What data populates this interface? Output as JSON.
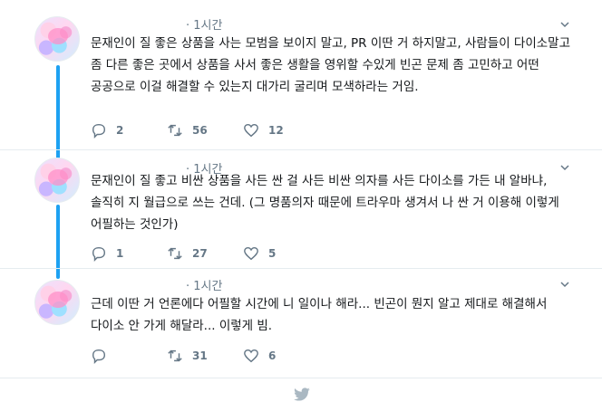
{
  "tweets": [
    {
      "time": "· 1시간",
      "text": "문재인이 질 좋은 상품을 사는 모범을 보이지 말고, PR 이딴 거 하지말고, 사람들이 다이소말고 좀 다른 좋은 곳에서 상품을 사서 좋은 생활을 영위할 수있게 빈곤 문제 좀 고민하고 어떤 공공으로 이걸 해결할 수 있는지 대가리 굴리며 모색하라는 거임.",
      "replies": "2",
      "retweets": "56",
      "likes": "12"
    },
    {
      "time": "· 1시간",
      "text": "문재인이 질 좋고 비싼 상품을 사든 싼 걸 사든 비싼 의자를 사든 다이소를 가든 내 알바냐, 솔직히 지 월급으로 쓰는 건데. (그 명품의자 때문에 트라우마 생겨서 나 싼 거 이용해 이렇게 어필하는 것인가)",
      "replies": "1",
      "retweets": "27",
      "likes": "5"
    },
    {
      "time": "· 1시간",
      "text": "근데 이딴 거 언론에다 어필할 시간에 니 일이나 해라... 빈곤이 뭔지 알고 제대로 해결해서 다이소 안 가게 해달라... 이렇게 빔.",
      "replies": "",
      "retweets": "31",
      "likes": "6"
    }
  ],
  "icons": {
    "reply": "reply-icon",
    "retweet": "retweet-icon",
    "like": "heart-icon",
    "more": "chevron-down-icon",
    "footer": "twitter-bird-icon"
  },
  "colors": {
    "thread": "#1da1f2",
    "muted": "#657786",
    "text": "#14171a"
  }
}
